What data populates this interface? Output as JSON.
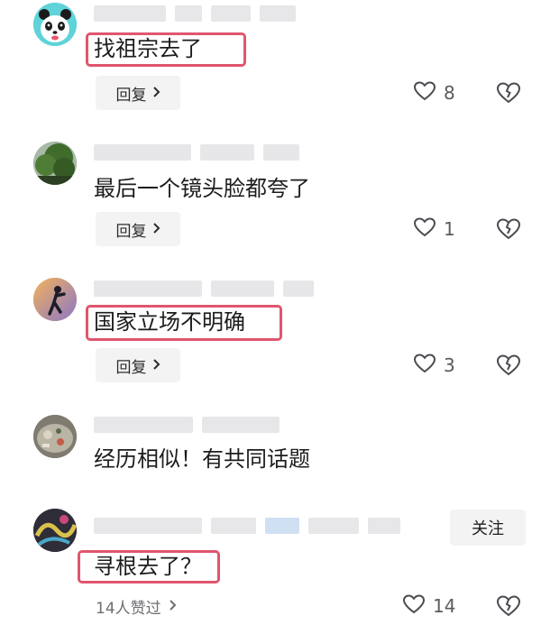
{
  "comments": [
    {
      "text": "找祖宗去了",
      "reply_label": "回复",
      "likes": "8"
    },
    {
      "text": "最后一个镜头脸都夸了",
      "reply_label": "回复",
      "likes": "1"
    },
    {
      "text": "国家立场不明确",
      "reply_label": "回复",
      "likes": "3"
    },
    {
      "text": "经历相似！有共同话题"
    },
    {
      "text": "寻根去了？",
      "follow_label": "关注",
      "likers_text": "14人赞过",
      "likes": "14"
    }
  ],
  "colors": {
    "highlight_border": "#e0566d",
    "button_bg": "#f3f3f4",
    "muted_text": "#6e6e73"
  },
  "icons": [
    "panda-avatar",
    "chevron-right-icon",
    "heart-icon",
    "broken-heart-icon"
  ]
}
